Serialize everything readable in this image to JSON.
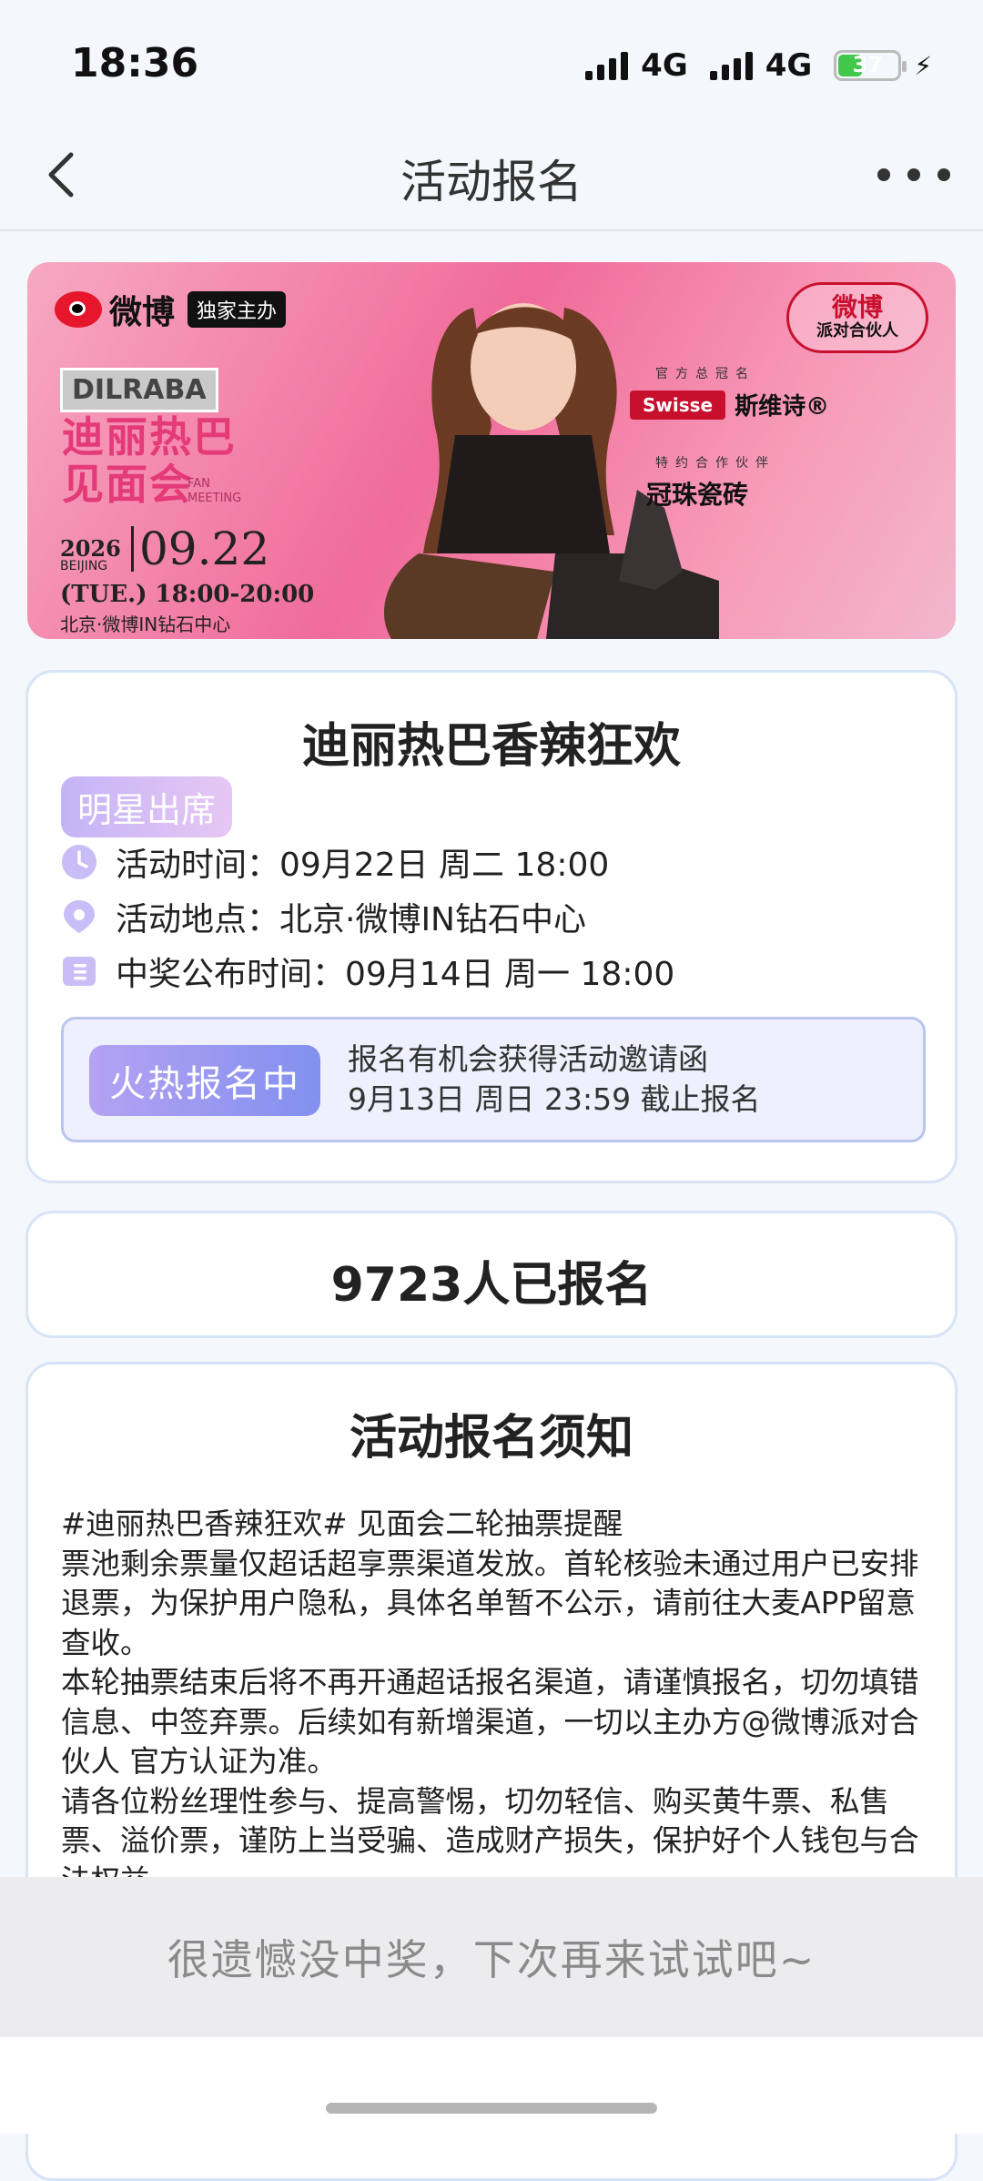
{
  "status_bar": {
    "time": "18:36",
    "network1": "4G",
    "network2": "4G",
    "battery": "37"
  },
  "nav": {
    "title": "活动报名"
  },
  "banner": {
    "weibo": "微博",
    "exclusive": "独家主办",
    "artist_en": "DILRABA",
    "title_line1": "迪丽热巴",
    "title_line2": "见面会",
    "title_en": "FAN MEETING",
    "year": "2026",
    "city_en": "BEIJING",
    "date": "09.22",
    "time": "(TUE.) 18:00-20:00",
    "venue": "北京·微博IN钻石中心",
    "party_line1": "微博",
    "party_line2": "派对合伙人",
    "sponsor_label1": "官方总冠名",
    "sponsor1_brand": "Swisse",
    "sponsor1_name": "斯维诗®",
    "sponsor_label2": "特约合作伙伴",
    "sponsor2_name": "冠珠瓷砖"
  },
  "event": {
    "title": "迪丽热巴香辣狂欢",
    "badge": "明星出席",
    "time_label": "活动时间：09月22日 周二 18:00",
    "place_label": "活动地点：北京·微博IN钻石中心",
    "announce_label": "中奖公布时间：09月14日 周一 18:00",
    "status_button": "火热报名中",
    "status_line1": "报名有机会获得活动邀请函",
    "status_line2": "9月13日 周日 23:59 截止报名"
  },
  "signup": {
    "count_text": "9723人已报名"
  },
  "notice": {
    "title": "活动报名须知",
    "paragraphs": [
      "#迪丽热巴香辣狂欢# 见面会二轮抽票提醒",
      "票池剩余票量仅超话超享票渠道发放。首轮核验未通过用户已安排退票，为保护用户隐私，具体名单暂不公示，请前往大麦APP留意查收。",
      "本轮抽票结束后将不再开通超话报名渠道，请谨慎报名，切勿填错信息、中签弃票。后续如有新增渠道，一切以主办方@微博派对合伙人 官方认证为准。",
      "请各位粉丝理性参与、提高警惕，切勿轻信、购买黄牛票、私售票、溢价票，谨防上当受骗、造成财产损失，保护好个人钱包与合法权益。"
    ]
  },
  "result": {
    "text": "很遗憾没中奖，下次再来试试吧~"
  }
}
